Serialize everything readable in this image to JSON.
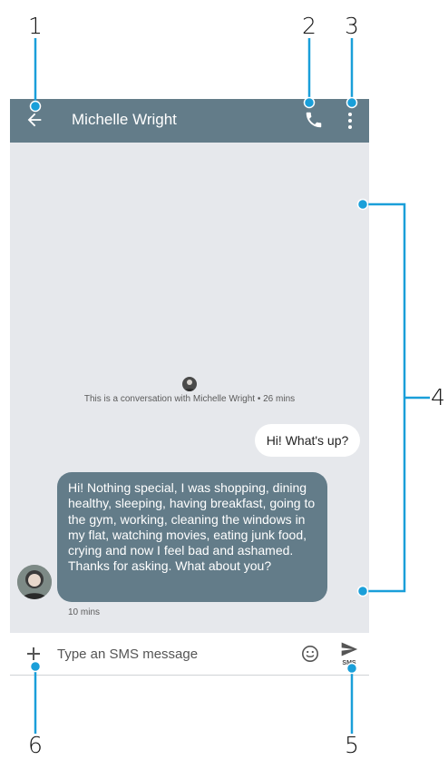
{
  "callouts": {
    "c1": "1",
    "c2": "2",
    "c3": "3",
    "c4": "4",
    "c5": "5",
    "c6": "6"
  },
  "header": {
    "contact_name": "Michelle Wright",
    "back_icon": "arrow-back-icon",
    "call_icon": "phone-icon",
    "menu_icon": "more-vert-icon"
  },
  "conversation": {
    "info_text": "This is a conversation with Michelle Wright • 26 mins",
    "messages": [
      {
        "direction": "outgoing",
        "text": "Hi! What's up?"
      },
      {
        "direction": "incoming",
        "text": "Hi! Nothing special, I was shopping, dining healthy, sleeping,  having breakfast, going to the gym, working, cleaning the windows in my flat, watching movies, eating junk food, crying and now I feel bad and ashamed. Thanks for asking. What about you?",
        "time": "10 mins"
      }
    ]
  },
  "composer": {
    "placeholder": "Type an SMS message",
    "send_label": "SMS",
    "attach_icon": "plus-icon",
    "emoji_icon": "smiley-icon",
    "send_icon": "send-icon"
  },
  "colors": {
    "accent": "#637c89",
    "callout": "#1a9fd9",
    "conversation_bg": "#e6e8ec"
  }
}
